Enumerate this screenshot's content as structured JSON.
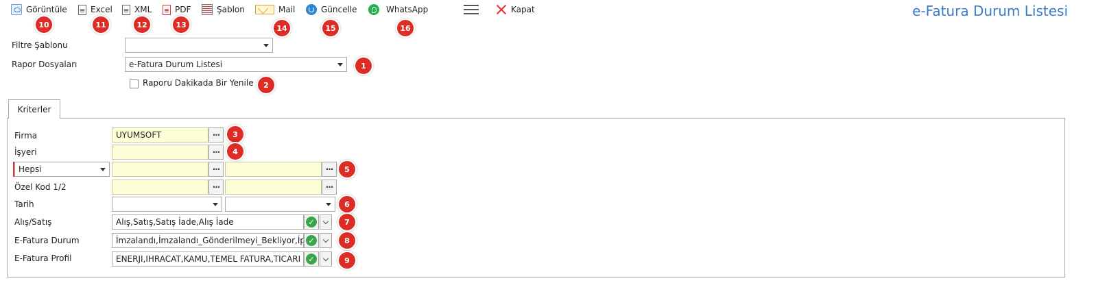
{
  "toolbar": {
    "view_label": "Görüntüle",
    "excel_label": "Excel",
    "xml_label": "XML",
    "pdf_label": "PDF",
    "sablon_label": "Şablon",
    "mail_label": "Mail",
    "guncelle_label": "Güncelle",
    "whatsapp_label": "WhatsApp",
    "close_label": "Kapat"
  },
  "page_title": "e-Fatura Durum Listesi",
  "top_form": {
    "filter_template_label": "Filtre Şablonu",
    "filter_template_value": "",
    "report_files_label": "Rapor Dosyaları",
    "report_files_value": "e-Fatura Durum Listesi",
    "refresh_checkbox_label": "Raporu Dakikada Bir Yenile"
  },
  "tab": {
    "label": "Kriterler"
  },
  "criteria": {
    "firma_label": "Firma",
    "firma_value": "UYUMSOFT",
    "isyeri_label": "İşyeri",
    "isyeri_value": "",
    "hepsi_value": "Hepsi",
    "hepsi_from": "",
    "hepsi_to": "",
    "ozelkod_label": "Özel Kod 1/2",
    "ozelkod_1": "",
    "ozelkod_2": "",
    "tarih_label": "Tarih",
    "tarih_from": "",
    "tarih_to": "",
    "alissatis_label": "Alış/Satış",
    "alissatis_value": "Alış,Satış,Satış İade,Alış İade",
    "durum_label": "E-Fatura Durum",
    "durum_value": "İmzalandı,İmzalandı_Gönderilmeyi_Bekliyor,İptal",
    "profil_label": "E-Fatura Profil",
    "profil_value": "ENERJI,IHRACAT,KAMU,TEMEL FATURA,TICARI"
  },
  "badges": [
    "1",
    "2",
    "3",
    "4",
    "5",
    "6",
    "7",
    "8",
    "9",
    "10",
    "11",
    "12",
    "13",
    "14",
    "15",
    "16"
  ],
  "colors": {
    "accent": "#3a7bc8",
    "badge": "#dd2b25",
    "input_highlight": "#fdfdd8",
    "ok_green": "#3aa64a"
  }
}
